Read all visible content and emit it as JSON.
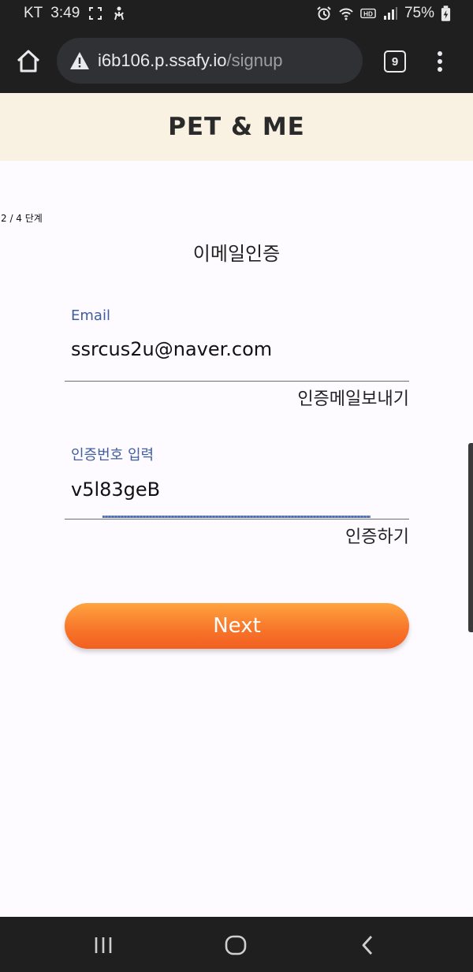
{
  "status_bar": {
    "carrier": "KT",
    "time": "3:49",
    "battery": "75%"
  },
  "browser": {
    "url_host": "i6b106.p.ssafy.io",
    "url_path": "/signup",
    "tab_count": "9"
  },
  "app": {
    "title": "PET & ME",
    "step_text": "2 / 4 단계",
    "section_title": "이메일인증"
  },
  "email_field": {
    "label": "Email",
    "value": "ssrcus2u@naver.com",
    "action_label": "인증메일보내기"
  },
  "code_field": {
    "label": "인증번호 입력",
    "value": "v5l83geB",
    "action_label": "인증하기"
  },
  "next_button": {
    "label": "Next"
  },
  "colors": {
    "header_bg": "#f9f2e3",
    "label_blue": "#3f5ea0",
    "button_orange": "#f7742a"
  },
  "icons": [
    "screenshot-icon",
    "accessibility-icon",
    "alarm-icon",
    "wifi-icon",
    "hd-icon",
    "signal-icon",
    "battery-icon",
    "home-icon",
    "warning-icon",
    "tabs-icon",
    "more-vert-icon",
    "recents-icon",
    "home-circle-icon",
    "back-icon"
  ]
}
